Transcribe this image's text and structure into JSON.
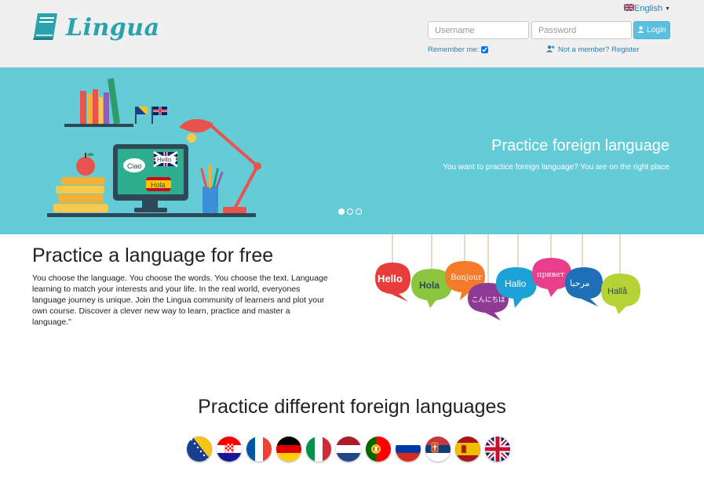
{
  "header": {
    "logo_text": "Lingua",
    "language_selector": {
      "selected": "English",
      "flag": "uk-flag-icon"
    },
    "username": {
      "placeholder": "Username",
      "value": ""
    },
    "password": {
      "placeholder": "Password",
      "value": ""
    },
    "login_label": "Login",
    "remember_label": "Remember me:",
    "remember_checked": true,
    "register_label": "Not a member? Register"
  },
  "hero": {
    "title": "Practice foreign language",
    "subtitle": "You want to practice foreign language? You are on the right place",
    "slides": 3,
    "active_slide": 1,
    "illustration_bubbles": [
      "Ciao",
      "Hello",
      "Hola"
    ]
  },
  "intro": {
    "title": "Practice a language for free",
    "text": "You choose the language. You choose the words. You choose the text. Language learning to match your interests and your life. In the real world, everyones language journey is unique. Join the Lingua community of learners and plot your own course. Discover a clever new way to learn, practice and master a language.\"",
    "greetings": [
      "Hello",
      "Hola",
      "Bonjour",
      "こんにちは",
      "Hallo",
      "привет",
      "مرحبا",
      "Hallå"
    ]
  },
  "languages": {
    "title": "Practice different foreign languages",
    "flags": [
      "bosnia-flag",
      "croatia-flag",
      "france-flag",
      "germany-flag",
      "italy-flag",
      "netherlands-flag",
      "portugal-flag",
      "russia-flag",
      "serbia-flag",
      "spain-flag",
      "uk-flag"
    ]
  },
  "colors": {
    "accent": "#2aa3ad",
    "hero_bg": "#63ccd6",
    "login_button": "#5bc0de",
    "link": "#2a7fb8"
  }
}
